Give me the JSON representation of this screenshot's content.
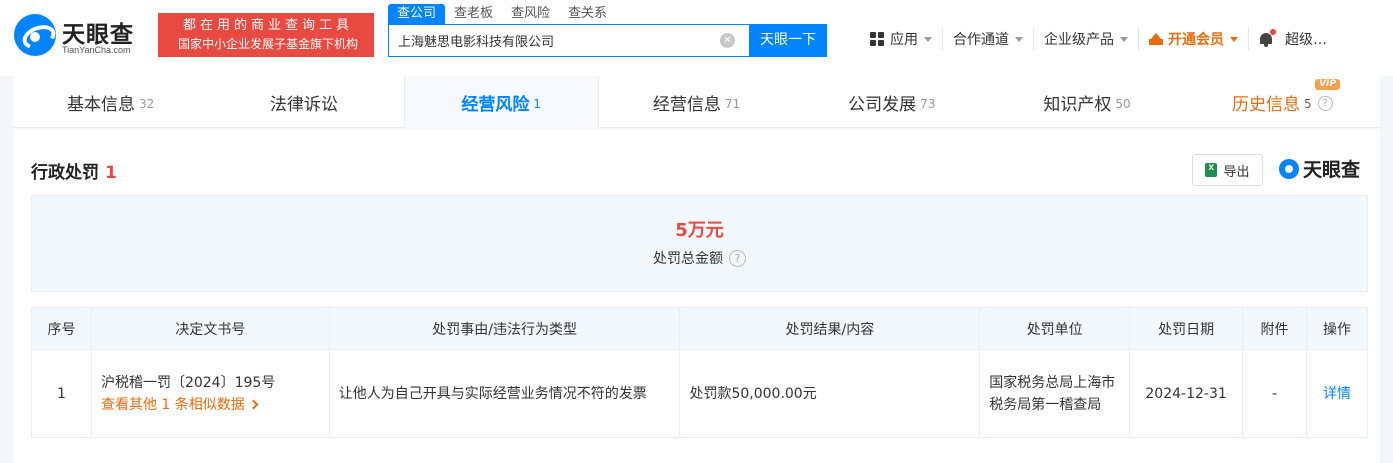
{
  "header": {
    "brand": "天眼查",
    "brand_en": "TianYanCha.com",
    "promo_line1": "都在用的商业查询工具",
    "promo_line2": "国家中小企业发展子基金旗下机构",
    "search_tabs": [
      "查公司",
      "查老板",
      "查风险",
      "查关系"
    ],
    "search_value": "上海魅思电影科技有限公司",
    "search_button": "天眼一下",
    "nav": {
      "apps": "应用",
      "channels": "合作通道",
      "enterprise": "企业级产品",
      "vip": "开通会员",
      "user": "超级…"
    }
  },
  "tabs": [
    {
      "label": "基本信息",
      "count": "32"
    },
    {
      "label": "法律诉讼",
      "count": ""
    },
    {
      "label": "经营风险",
      "count": "1"
    },
    {
      "label": "经营信息",
      "count": "71"
    },
    {
      "label": "公司发展",
      "count": "73"
    },
    {
      "label": "知识产权",
      "count": "50"
    },
    {
      "label": "历史信息",
      "count": "5",
      "badge": "VIP"
    }
  ],
  "section": {
    "title": "行政处罚",
    "count": "1",
    "export_label": "导出",
    "watermark": "天眼查",
    "total_amount": "5万元",
    "total_label": "处罚总金额"
  },
  "table": {
    "headers": [
      "序号",
      "决定文书号",
      "处罚事由/违法行为类型",
      "处罚结果/内容",
      "处罚单位",
      "处罚日期",
      "附件",
      "操作"
    ],
    "rows": [
      {
        "index": "1",
        "doc_no": "沪税稽一罚〔2024〕195号",
        "similar_link": "查看其他 1 条相似数据",
        "reason": "让他人为自己开具与实际经营业务情况不符的发票",
        "result": "处罚款50,000.00元",
        "authority": "国家税务总局上海市税务局第一稽查局",
        "date": "2024-12-31",
        "attachment": "-",
        "action": "详情"
      }
    ]
  },
  "colors": {
    "primary": "#0084ff",
    "danger": "#e84940",
    "vip": "#e96d0d"
  }
}
